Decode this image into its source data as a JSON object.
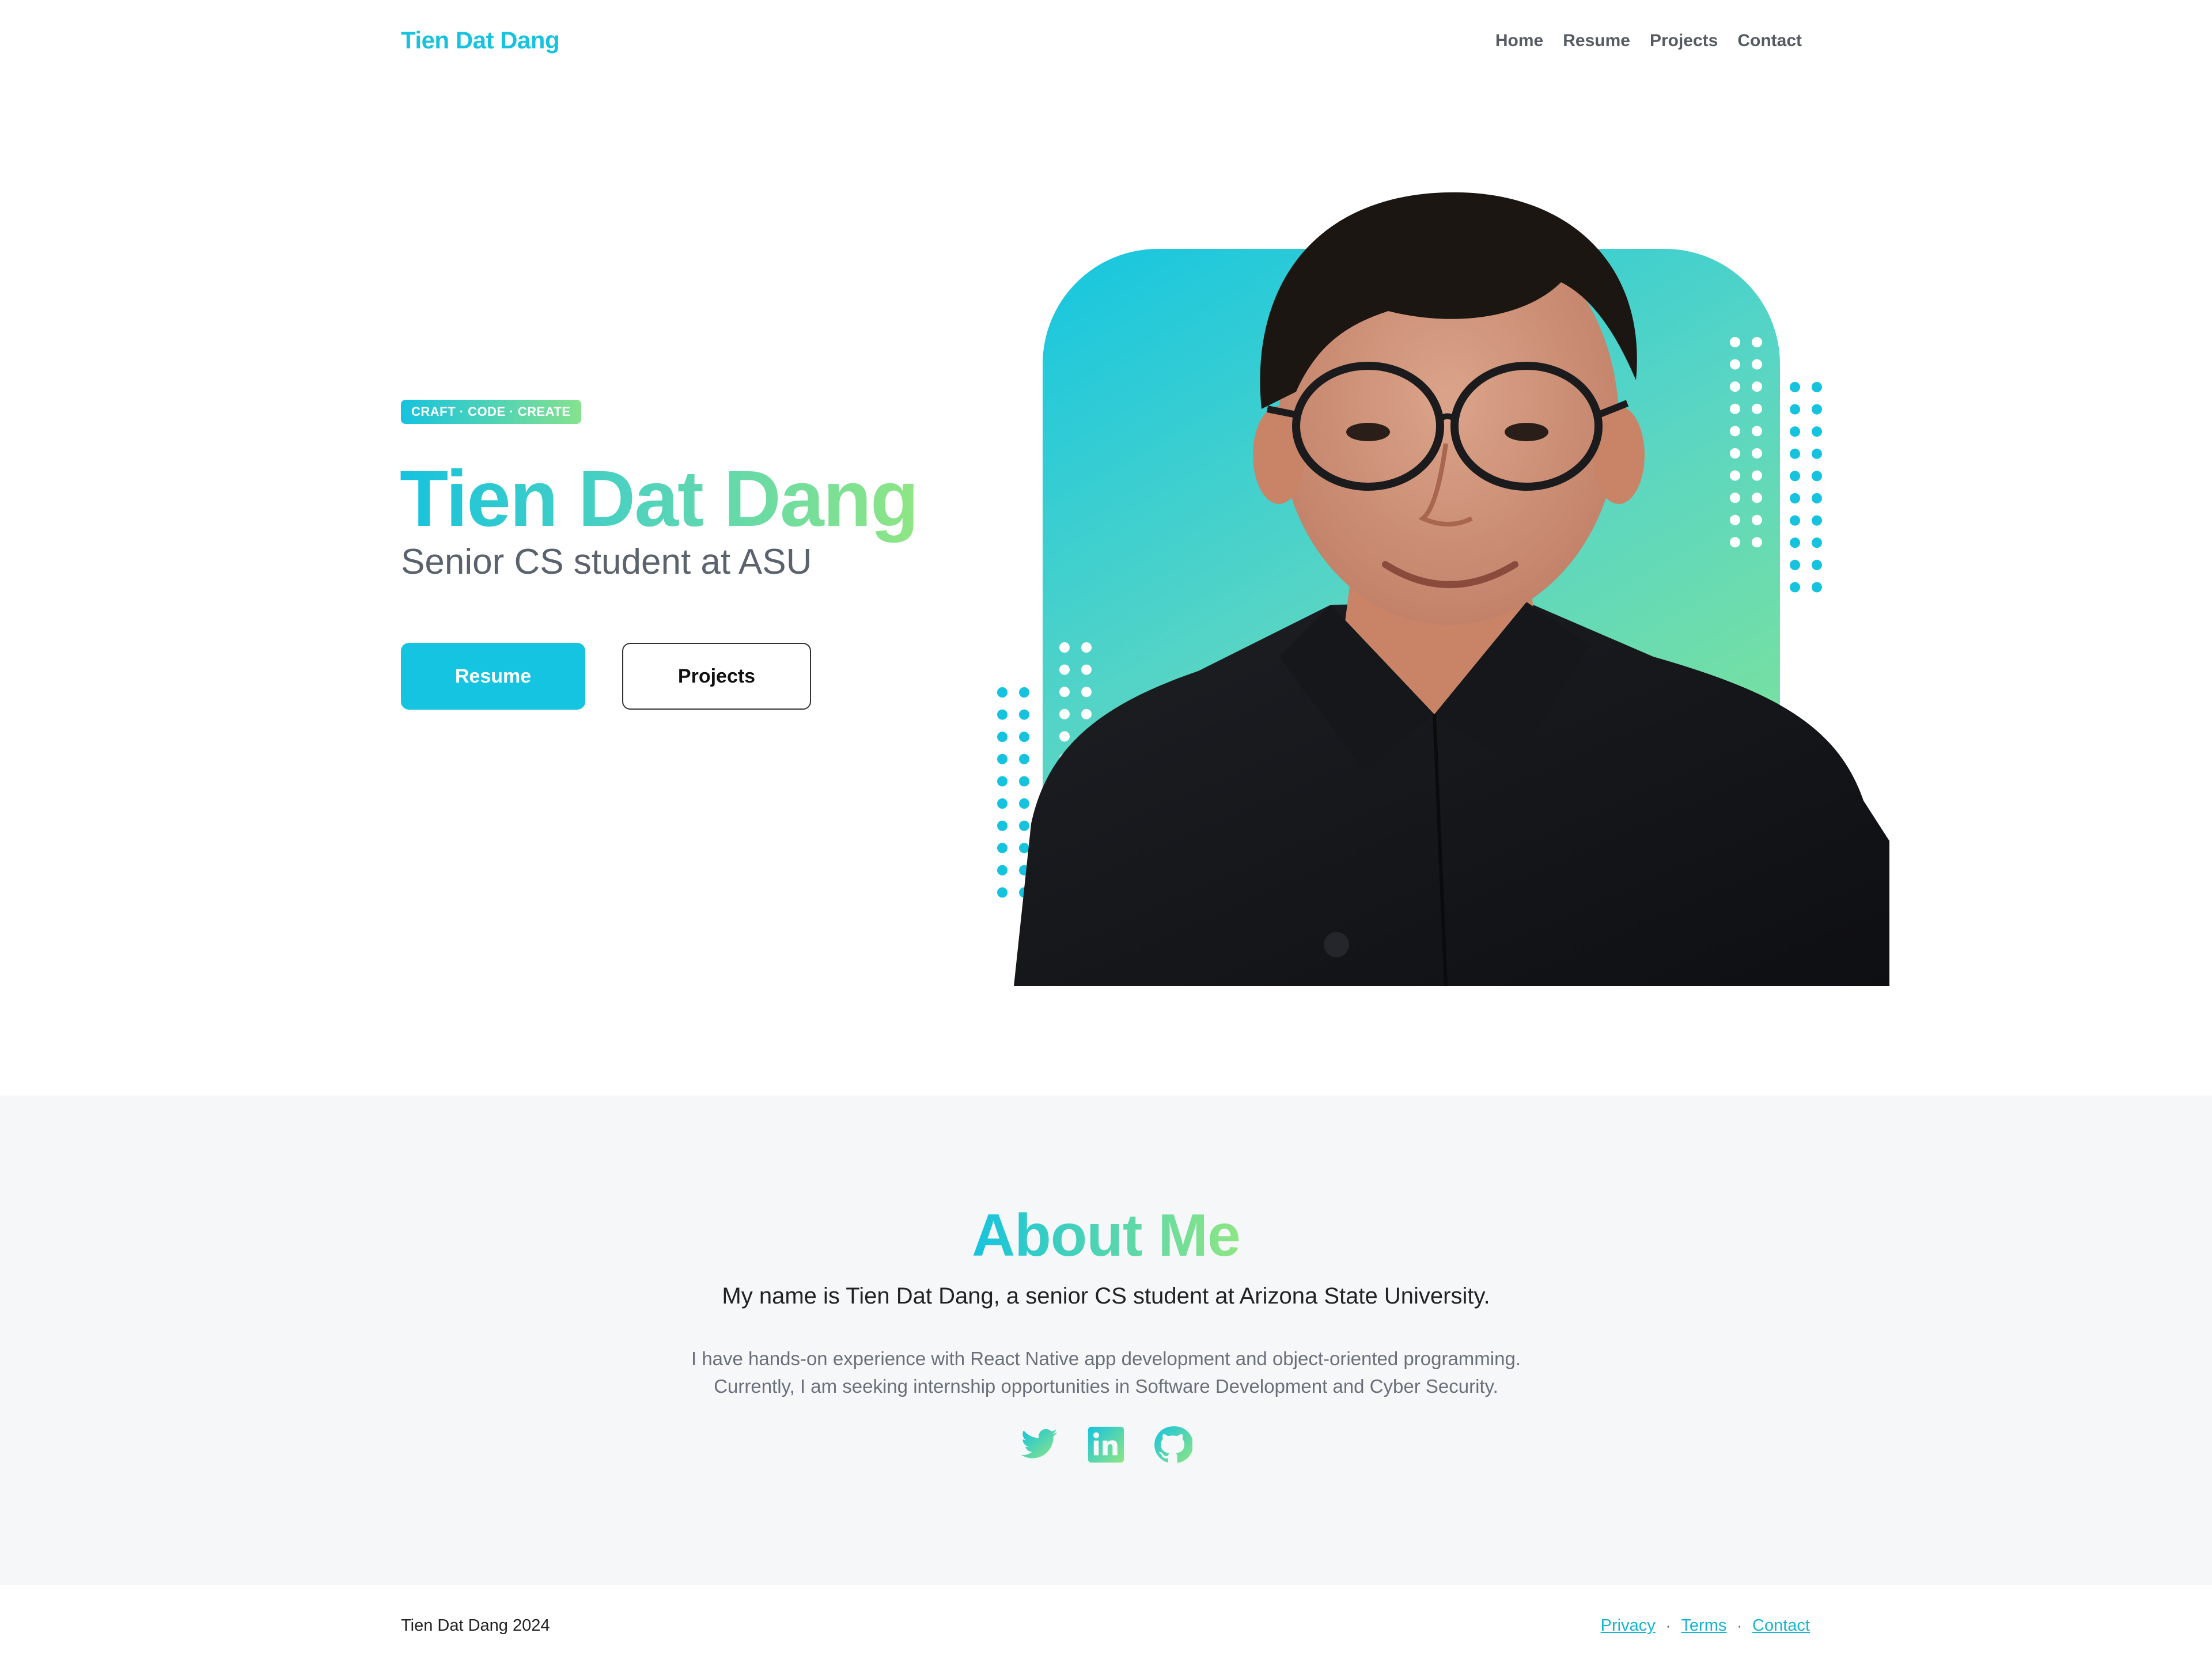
{
  "nav": {
    "brand": "Tien Dat Dang",
    "links": [
      "Home",
      "Resume",
      "Projects",
      "Contact"
    ]
  },
  "hero": {
    "tagline": "CRAFT · CODE · CREATE",
    "title": "Tien Dat Dang",
    "subtitle": "Senior CS student at ASU",
    "primary_button": "Resume",
    "secondary_button": "Projects"
  },
  "about": {
    "title": "About Me",
    "lead": "My name is Tien Dat Dang, a senior CS student at Arizona State University.",
    "paragraph_line1": "I have hands-on experience with React Native app development and object-oriented programming.",
    "paragraph_line2": "Currently, I am seeking internship opportunities in Software Development and Cyber Security.",
    "social_icons": [
      "twitter-icon",
      "linkedin-icon",
      "github-icon"
    ]
  },
  "footer": {
    "copyright": "Tien Dat Dang 2024",
    "links": [
      "Privacy",
      "Terms",
      "Contact"
    ],
    "separator": "·"
  },
  "colors": {
    "accent": "#16c3de",
    "accent_green": "#8fe683",
    "button_primary": "#14c4e0",
    "section_bg": "#f6f7f9",
    "dark_text": "#111111"
  }
}
